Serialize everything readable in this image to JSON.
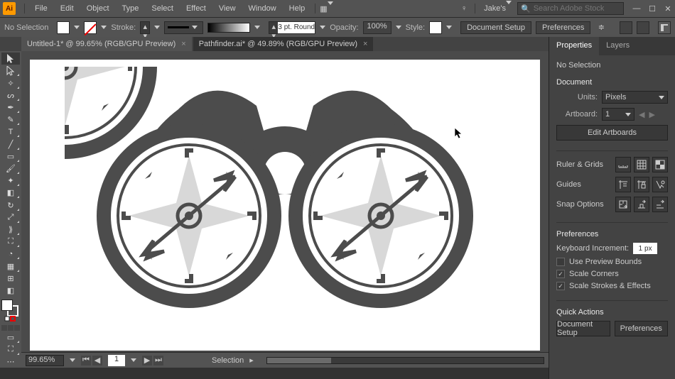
{
  "menu": {
    "items": [
      "File",
      "Edit",
      "Object",
      "Type",
      "Select",
      "Effect",
      "View",
      "Window",
      "Help"
    ],
    "user": "Jake's",
    "searchPlaceholder": "Search Adobe Stock"
  },
  "app": {
    "logo": "Ai"
  },
  "control": {
    "selection": "No Selection",
    "strokeLabel": "Stroke:",
    "weight": "3 pt. Round",
    "opacityLabel": "Opacity:",
    "opacity": "100%",
    "styleLabel": "Style:",
    "docSetup": "Document Setup",
    "prefs": "Preferences"
  },
  "tabs": [
    {
      "label": "Untitled-1* @ 99.65% (RGB/GPU Preview)",
      "active": true
    },
    {
      "label": "Pathfinder.ai* @ 49.89% (RGB/GPU Preview)",
      "active": false
    }
  ],
  "status": {
    "zoom": "99.65%",
    "page": "1",
    "mode": "Selection"
  },
  "panel": {
    "tabs": [
      "Properties",
      "Layers"
    ],
    "active": 0,
    "noSel": "No Selection",
    "docHead": "Document",
    "unitsLabel": "Units:",
    "unitsVal": "Pixels",
    "artboardLabel": "Artboard:",
    "artboardVal": "1",
    "editArtboards": "Edit Artboards",
    "rulers": "Ruler & Grids",
    "guides": "Guides",
    "snap": "Snap Options",
    "prefsHead": "Preferences",
    "kbInc": "Keyboard Increment:",
    "kbIncVal": "1 px",
    "usePrev": "Use Preview Bounds",
    "scaleCorners": "Scale Corners",
    "scaleStrokes": "Scale Strokes & Effects",
    "quick": "Quick Actions",
    "qa1": "Document Setup",
    "qa2": "Preferences"
  }
}
